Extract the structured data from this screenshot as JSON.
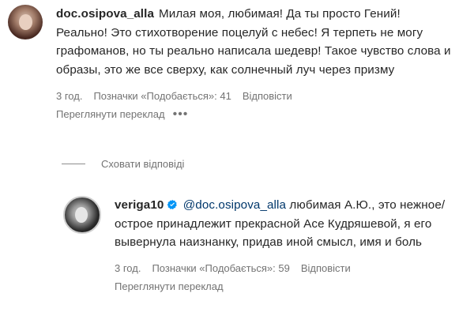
{
  "comment": {
    "username": "doc.osipova_alla",
    "text": "Милая моя, любимая! Да ты просто Гений! Реально! Это стихотворение поцелуй с небес! Я терпеть не могу графоманов, но ты реально написала шедевр! Такое чувство слова и образы, это же все сверху, как солнечный луч через призму",
    "time": "3 год.",
    "likes": "Позначки «Подобається»: 41",
    "reply": "Відповісти",
    "translate": "Переглянути переклад",
    "more": "•••"
  },
  "hide_replies": "Сховати відповіді",
  "reply_comment": {
    "username": "veriga10",
    "verified": true,
    "mention": "@doc.osipova_alla",
    "text": "любимая А.Ю., это нежное/острое принадлежит прекрасной Асе Кудряшевой, я его вывернула наизнанку, придав иной смысл, имя и боль",
    "time": "3 год.",
    "likes": "Позначки «Подобається»: 59",
    "reply": "Відповісти",
    "translate": "Переглянути переклад"
  },
  "colors": {
    "text": "#262626",
    "secondary": "#737373",
    "mention": "#00376b",
    "verified": "#0095f6"
  }
}
